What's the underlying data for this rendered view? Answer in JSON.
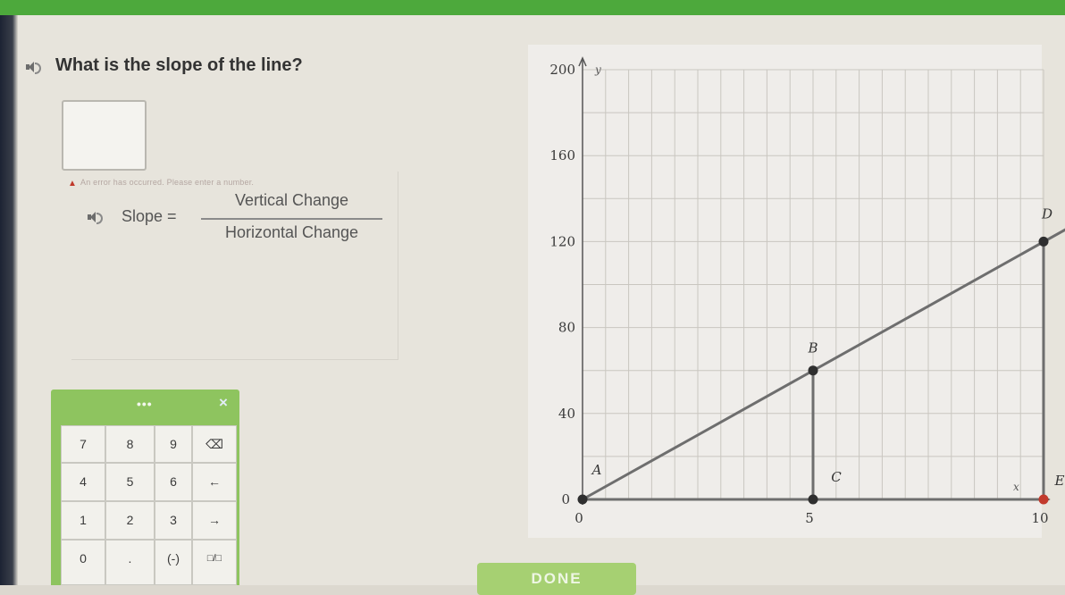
{
  "question": {
    "text": "What is the slope of the line?",
    "answer_value": "",
    "error_message": "An error has occurred. Please enter a number."
  },
  "formula": {
    "lhs": "Slope =",
    "numerator": "Vertical Change",
    "denominator": "Horizontal Change"
  },
  "keypad": {
    "handle": "•••",
    "close": "×",
    "keys": [
      "7",
      "8",
      "9",
      "⌫",
      "4",
      "5",
      "6",
      "←",
      "1",
      "2",
      "3",
      "→",
      "0",
      ".",
      "(-)",
      "□/□"
    ]
  },
  "chart_data": {
    "type": "line",
    "x_label": "x",
    "y_label": "y",
    "xlim": [
      0,
      10
    ],
    "ylim": [
      0,
      200
    ],
    "x_ticks": [
      "0",
      "5",
      "10"
    ],
    "y_ticks": [
      "0",
      "40",
      "80",
      "120",
      "160",
      "200"
    ],
    "grid": true,
    "line": {
      "slope": 12,
      "intercept": 0
    },
    "points": [
      {
        "label": "A",
        "x": 0,
        "y": 0
      },
      {
        "label": "B",
        "x": 5,
        "y": 60
      },
      {
        "label": "C",
        "x": 5,
        "y": 0
      },
      {
        "label": "D",
        "x": 10,
        "y": 120
      },
      {
        "label": "E",
        "x": 10,
        "y": 0
      }
    ],
    "segments": [
      [
        "B",
        "C"
      ],
      [
        "D",
        "E"
      ],
      [
        "A",
        "E"
      ]
    ],
    "colors": {
      "line": "#6e6e6e",
      "point": "#2f2f2f",
      "point_E": "#c23a2c",
      "grid": "#c9c6c0"
    }
  },
  "done": {
    "label": "DONE"
  }
}
